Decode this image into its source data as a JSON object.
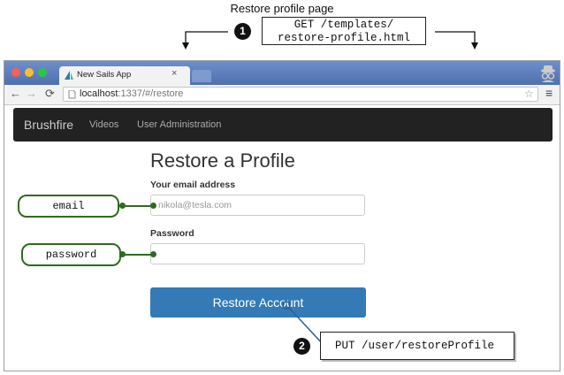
{
  "annotations": {
    "top_caption": "Restore profile page",
    "request_get_line1": "GET /templates/",
    "request_get_line2": "restore-profile.html",
    "step1": "1",
    "step2": "2",
    "request_put": "PUT /user/restoreProfile",
    "email_callout": "email",
    "password_callout": "password"
  },
  "browser": {
    "tab_title": "New Sails App",
    "tab_close": "×",
    "url_host": "localhost",
    "url_path": ":1337/#/restore"
  },
  "navbar": {
    "brand": "Brushfire",
    "links": [
      "Videos",
      "User Administration"
    ]
  },
  "form": {
    "title": "Restore a Profile",
    "email_label": "Your email address",
    "email_placeholder": "nikola@tesla.com",
    "password_label": "Password",
    "submit_label": "Restore Account"
  },
  "colors": {
    "navbar_bg": "#222222",
    "button_bg": "#337ab7",
    "callout_green": "#2e6b1f",
    "tabbar_blue": "#5a7cb8"
  }
}
